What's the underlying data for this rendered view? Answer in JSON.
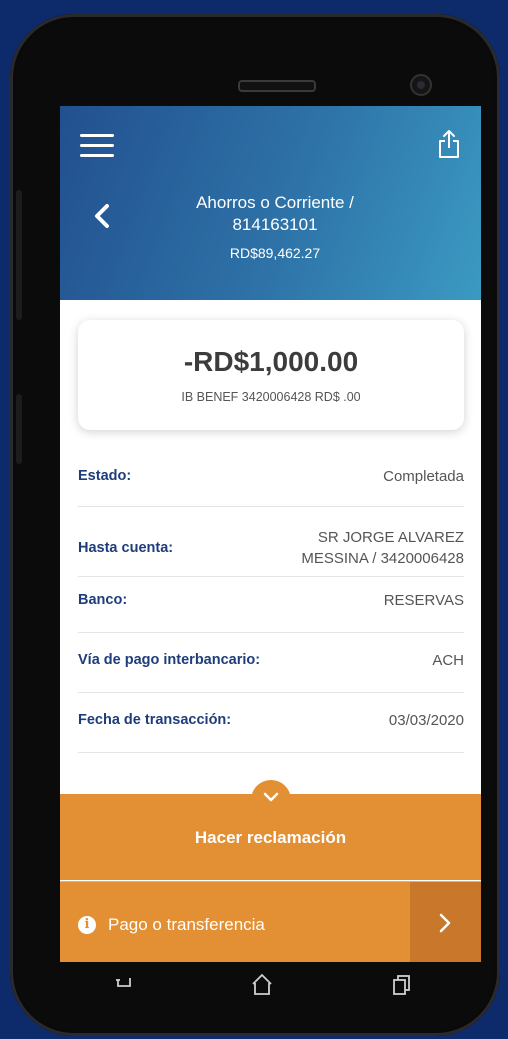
{
  "header": {
    "title_line1": "Ahorros o Corriente /",
    "title_line2": "814163101",
    "balance": "RD$89,462.27"
  },
  "transaction": {
    "amount": "-RD$1,000.00",
    "description": "IB BENEF 3420006428 RD$ .00"
  },
  "details": [
    {
      "label": "Estado:",
      "value": "Completada"
    },
    {
      "label": "Hasta cuenta:",
      "value_line1": "SR JORGE ALVAREZ",
      "value_line2": "MESSINA / 3420006428"
    },
    {
      "label": "Banco:",
      "value": "RESERVAS"
    },
    {
      "label": "Vía de pago interbancario:",
      "value": "ACH"
    },
    {
      "label": "Fecha de transacción:",
      "value": "03/03/2020"
    }
  ],
  "actions": {
    "claim_label": "Hacer reclamación",
    "bottom_label": "Pago o transferencia"
  },
  "icons": {
    "menu": "menu-icon",
    "share": "share-icon",
    "back": "chevron-left-icon",
    "info": "info-icon",
    "forward": "chevron-right-icon",
    "expand": "chevron-down-icon"
  },
  "colors": {
    "header_start": "#22508f",
    "header_end": "#3b9ac2",
    "accent_orange": "#e38f33",
    "label_blue": "#1e3d7a"
  }
}
